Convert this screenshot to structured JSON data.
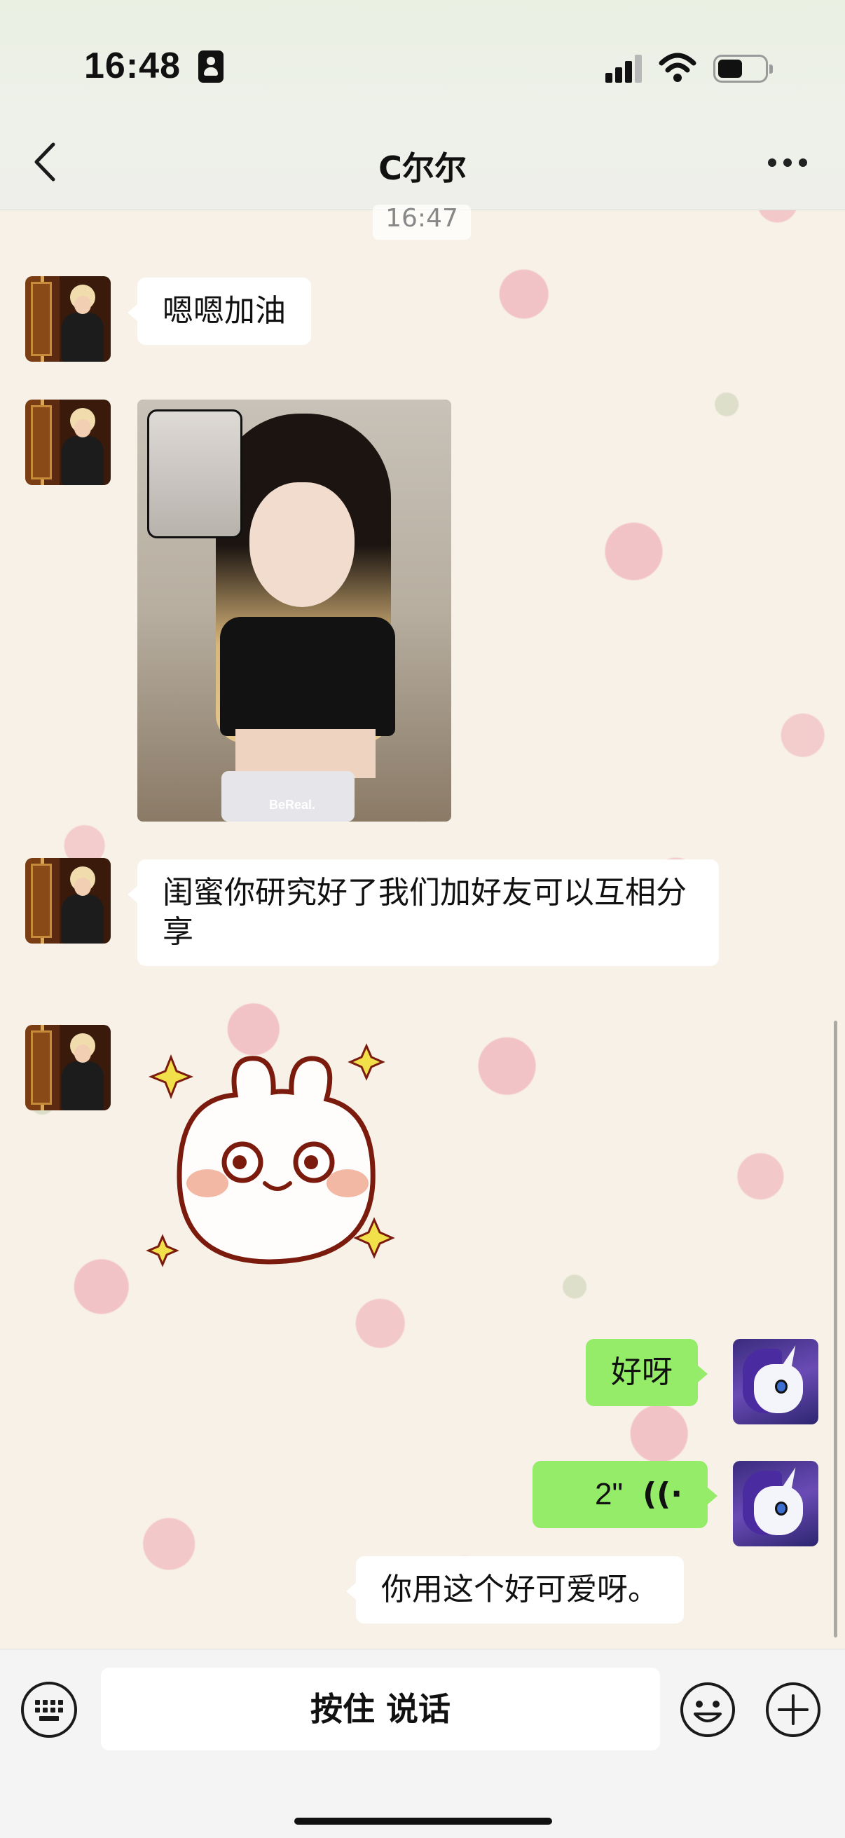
{
  "status_bar": {
    "time": "16:48"
  },
  "nav": {
    "title": "C尔尔",
    "back_icon": "chevron-left-icon",
    "more_icon": "more-dots-icon"
  },
  "chat": {
    "timestamp": "16:47",
    "messages": [
      {
        "from": "them",
        "type": "text",
        "text": "嗯嗯加油"
      },
      {
        "from": "them",
        "type": "image",
        "caption": "BeReal."
      },
      {
        "from": "them",
        "type": "text",
        "text": "闺蜜你研究好了我们加好友可以互相分享"
      },
      {
        "from": "them",
        "type": "sticker"
      },
      {
        "from": "me",
        "type": "text",
        "text": "好呀"
      },
      {
        "from": "me",
        "type": "voice",
        "duration": "2\""
      },
      {
        "from": "me",
        "type": "text",
        "text": "你用这个好可爱呀。"
      }
    ]
  },
  "input_bar": {
    "talk_label": "按住 说话",
    "keyboard_icon": "keyboard-icon",
    "emoji_icon": "emoji-icon",
    "plus_icon": "plus-icon"
  },
  "colors": {
    "incoming_bubble": "#ffffff",
    "outgoing_bubble": "#95ec69"
  }
}
